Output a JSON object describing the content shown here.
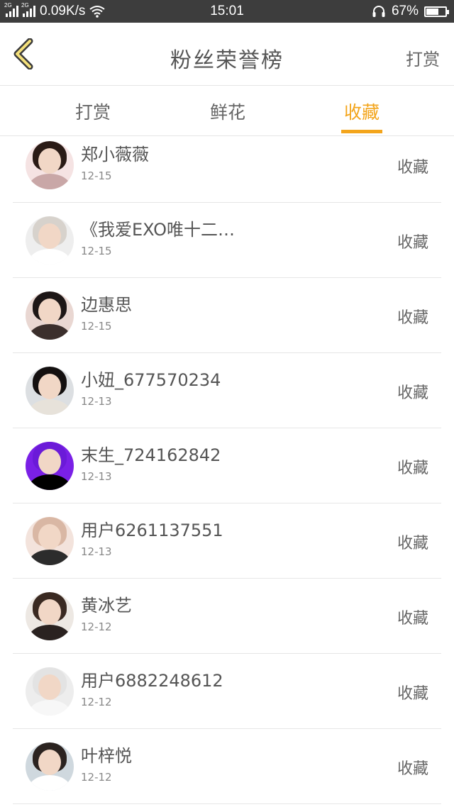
{
  "status_bar": {
    "network_label_1": "2G",
    "network_label_2": "2G",
    "speed": "0.09K/s",
    "time": "15:01",
    "battery": "67%",
    "battery_level": 0.67
  },
  "header": {
    "back_icon": "chevron-left-icon",
    "title": "粉丝荣誉榜",
    "action_label": "打赏"
  },
  "tabs": [
    {
      "label": "打赏",
      "active": false
    },
    {
      "label": "鲜花",
      "active": false
    },
    {
      "label": "收藏",
      "active": true
    }
  ],
  "colors": {
    "accent": "#f3a51c",
    "status_bar_bg": "#3d3d3d"
  },
  "rows": [
    {
      "name": "郑小薇薇",
      "date": "12-15",
      "action": "收藏",
      "avatar": {
        "hair": "#2a1b16",
        "bg": "#f5e3e3",
        "body": "#c9a7a7"
      }
    },
    {
      "name": "《我爱EXO唯十二…",
      "date": "12-15",
      "action": "收藏",
      "avatar": {
        "hair": "#d7d2cc",
        "bg": "#eeeeee",
        "body": "#ffffff"
      }
    },
    {
      "name": "边惠思",
      "date": "12-15",
      "action": "收藏",
      "avatar": {
        "hair": "#1d1717",
        "bg": "#e9d7d2",
        "body": "#3b2f2c"
      }
    },
    {
      "name": "小妞_677570234",
      "date": "12-13",
      "action": "收藏",
      "avatar": {
        "hair": "#141010",
        "bg": "#dcdfe2",
        "body": "#e7e2da"
      }
    },
    {
      "name": "末生_724162842",
      "date": "12-13",
      "action": "收藏",
      "avatar": {
        "hair": "#6b1ad8",
        "bg": "#7a20e6",
        "body": "#000000"
      }
    },
    {
      "name": "用户6261137551",
      "date": "12-13",
      "action": "收藏",
      "avatar": {
        "hair": "#d9b7a4",
        "bg": "#f3e3dc",
        "body": "#2c2c2c"
      }
    },
    {
      "name": "黄冰艺",
      "date": "12-12",
      "action": "收藏",
      "avatar": {
        "hair": "#3a2a22",
        "bg": "#ede8e3",
        "body": "#2a2220"
      }
    },
    {
      "name": "用户6882248612",
      "date": "12-12",
      "action": "收藏",
      "avatar": {
        "hair": "#e3e3e3",
        "bg": "#ededed",
        "body": "#f7f7f7"
      }
    },
    {
      "name": "叶梓悦",
      "date": "12-12",
      "action": "收藏",
      "avatar": {
        "hair": "#2b2320",
        "bg": "#cfd8de",
        "body": "#ffffff"
      }
    }
  ]
}
